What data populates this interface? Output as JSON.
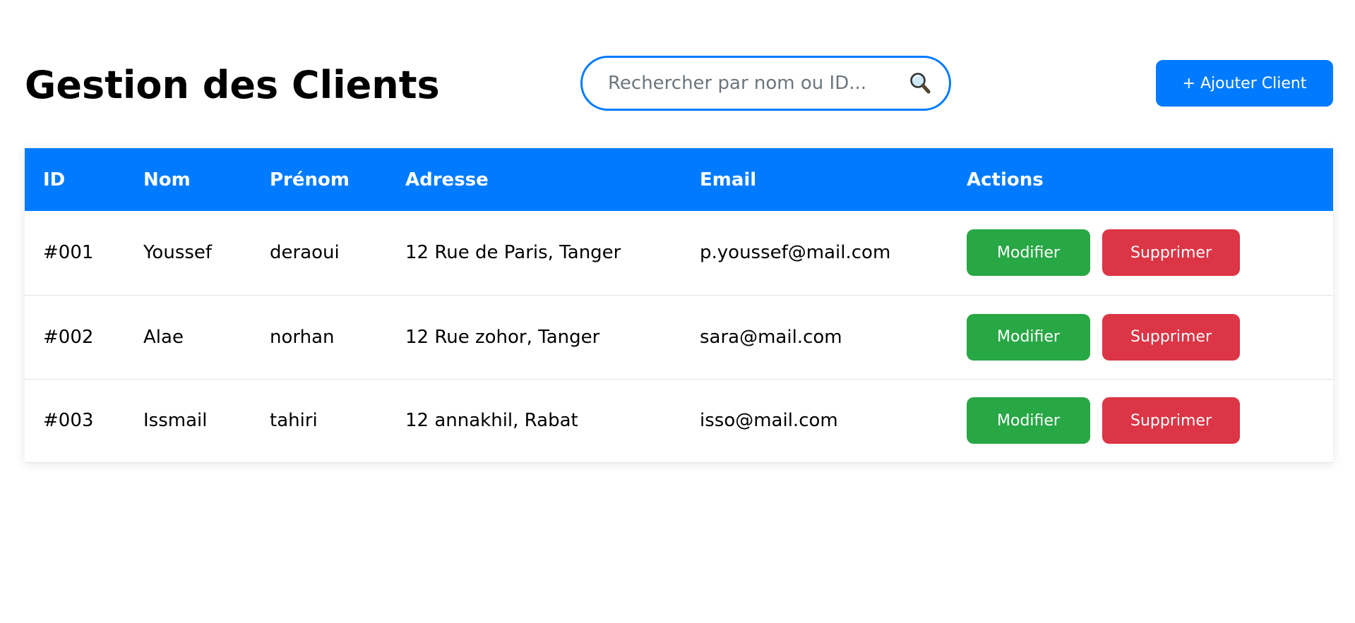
{
  "header": {
    "title": "Gestion des Clients",
    "search_placeholder": "Rechercher par nom ou ID...",
    "search_icon": "magnifying-glass",
    "add_button_label": "+ Ajouter Client"
  },
  "table": {
    "columns": [
      "ID",
      "Nom",
      "Prénom",
      "Adresse",
      "Email",
      "Actions"
    ],
    "rows": [
      {
        "id": "#001",
        "nom": "Youssef",
        "prenom": "deraoui",
        "adresse": "12 Rue de Paris, Tanger",
        "email": "p.youssef@mail.com"
      },
      {
        "id": "#002",
        "nom": "Alae",
        "prenom": "norhan",
        "adresse": "12 Rue zohor, Tanger",
        "email": "sara@mail.com"
      },
      {
        "id": "#003",
        "nom": "Issmail",
        "prenom": "tahiri",
        "adresse": "12 annakhil, Rabat",
        "email": "isso@mail.com"
      }
    ],
    "edit_label": "Modifier",
    "delete_label": "Supprimer"
  },
  "colors": {
    "primary": "#007bff",
    "success": "#28a745",
    "danger": "#dc3545"
  }
}
